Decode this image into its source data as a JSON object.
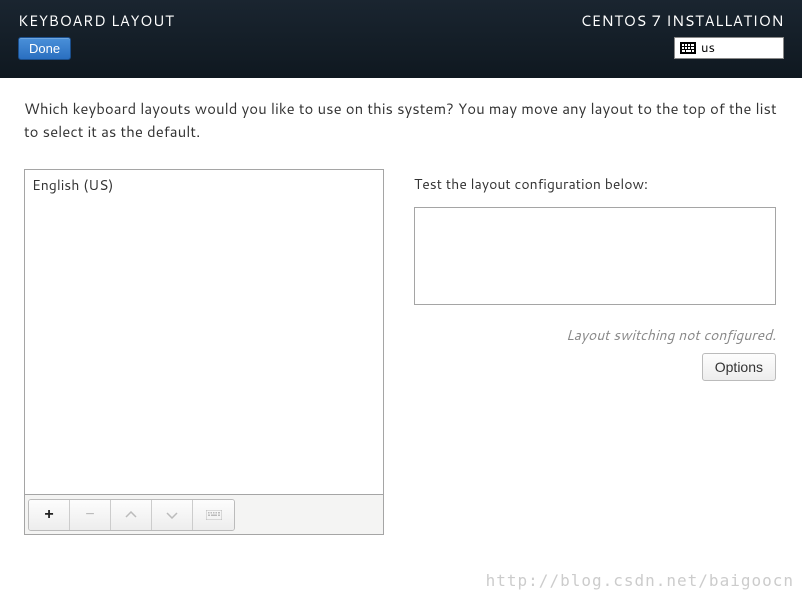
{
  "header": {
    "title": "KEYBOARD LAYOUT",
    "subtitle": "CENTOS 7 INSTALLATION",
    "done_label": "Done",
    "kbd_indicator": "us"
  },
  "description": "Which keyboard layouts would you like to use on this system?  You may move any layout to the top of the list to select it as the default.",
  "layouts": {
    "items": [
      {
        "label": "English (US)"
      }
    ]
  },
  "toolbar": {
    "add": "+",
    "remove": "−",
    "up": "˄",
    "down": "˅"
  },
  "test": {
    "label": "Test the layout configuration below:",
    "value": ""
  },
  "switch_status": "Layout switching not configured.",
  "options_label": "Options",
  "watermark": "http://blog.csdn.net/baigoocn"
}
